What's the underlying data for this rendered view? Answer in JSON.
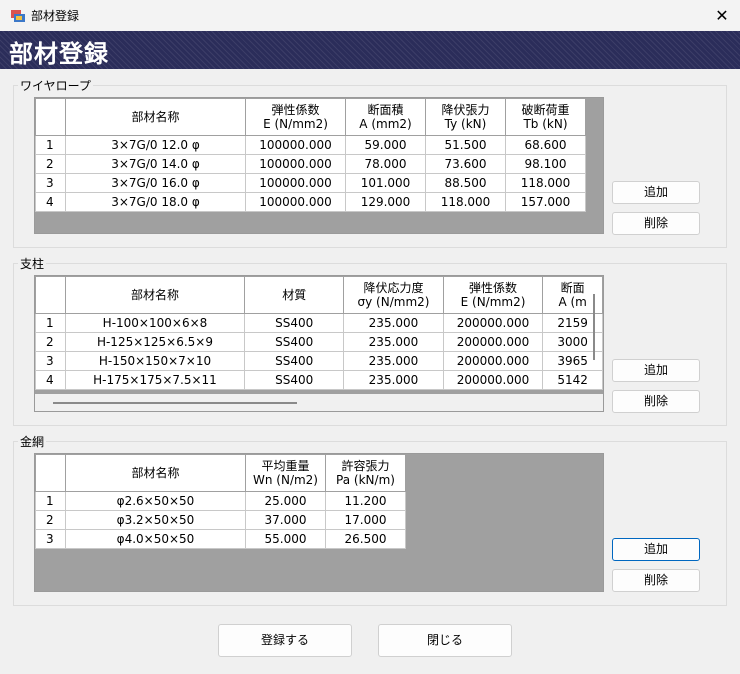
{
  "window": {
    "title": "部材登録",
    "close_glyph": "✕"
  },
  "banner": {
    "title": "部材登録"
  },
  "wire": {
    "label": "ワイヤロープ",
    "headers": [
      "",
      "部材名称",
      "弾性係数\nE (N/mm2)",
      "断面積\nA (mm2)",
      "降伏張力\nTy (kN)",
      "破断荷重\nTb (kN)"
    ],
    "rows": [
      [
        "1",
        "3×7G/0 12.0 φ",
        "100000.000",
        "59.000",
        "51.500",
        "68.600"
      ],
      [
        "2",
        "3×7G/0 14.0 φ",
        "100000.000",
        "78.000",
        "73.600",
        "98.100"
      ],
      [
        "3",
        "3×7G/0 16.0 φ",
        "100000.000",
        "101.000",
        "88.500",
        "118.000"
      ],
      [
        "4",
        "3×7G/0 18.0 φ",
        "100000.000",
        "129.000",
        "118.000",
        "157.000"
      ]
    ],
    "add_label": "追加",
    "delete_label": "削除"
  },
  "post": {
    "label": "支柱",
    "headers": [
      "",
      "部材名称",
      "材質",
      "降伏応力度\nσy (N/mm2)",
      "弾性係数\nE (N/mm2)",
      "断面\nA (m"
    ],
    "rows": [
      [
        "1",
        "H-100×100×6×8",
        "SS400",
        "235.000",
        "200000.000",
        "2159"
      ],
      [
        "2",
        "H-125×125×6.5×9",
        "SS400",
        "235.000",
        "200000.000",
        "3000"
      ],
      [
        "3",
        "H-150×150×7×10",
        "SS400",
        "235.000",
        "200000.000",
        "3965"
      ],
      [
        "4",
        "H-175×175×7.5×11",
        "SS400",
        "235.000",
        "200000.000",
        "5142"
      ]
    ],
    "add_label": "追加",
    "delete_label": "削除"
  },
  "mesh": {
    "label": "金網",
    "headers": [
      "",
      "部材名称",
      "平均重量\nWn (N/m2)",
      "許容張力\nPa (kN/m)"
    ],
    "rows": [
      [
        "1",
        "φ2.6×50×50",
        "25.000",
        "11.200"
      ],
      [
        "2",
        "φ3.2×50×50",
        "37.000",
        "17.000"
      ],
      [
        "3",
        "φ4.0×50×50",
        "55.000",
        "26.500"
      ]
    ],
    "add_label": "追加",
    "delete_label": "削除"
  },
  "footer": {
    "register_label": "登録する",
    "close_label": "閉じる"
  }
}
